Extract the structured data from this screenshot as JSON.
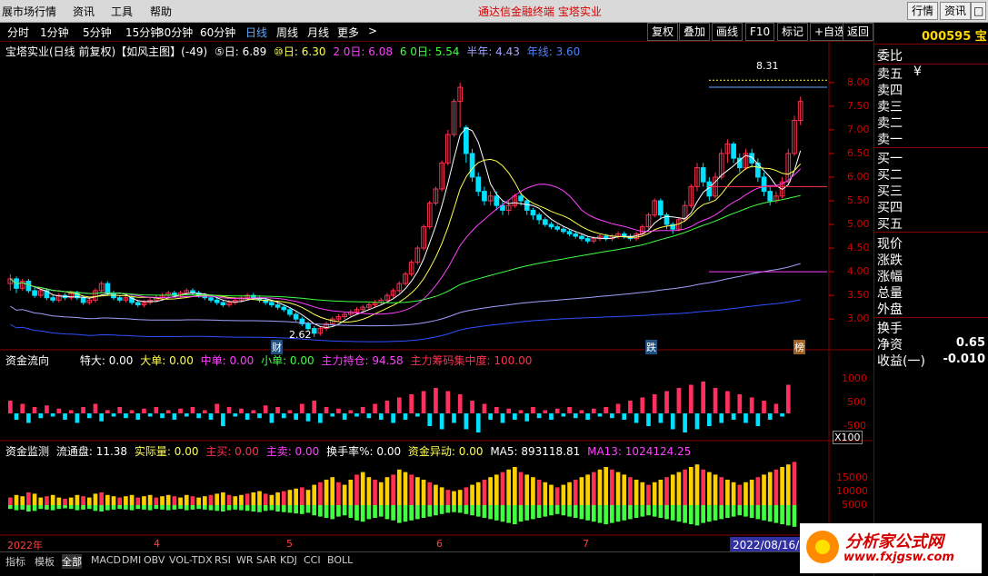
{
  "menubar": {
    "items": [
      "展市场行情",
      "资讯",
      "工具",
      "帮助"
    ],
    "brand": "通达信金融终端   宝塔实业",
    "right_buttons": [
      "行情",
      "资讯",
      "□",
      "×"
    ]
  },
  "periods": [
    "分时",
    "1分钟",
    "5分钟",
    "15分钟",
    "30分钟",
    "60分钟",
    "日线",
    "周线",
    "月线",
    "更多",
    ">"
  ],
  "active_period": "日线",
  "tools": [
    "复权",
    "叠加",
    "画线",
    "F10",
    "标记",
    "+自选",
    "返回"
  ],
  "main_legend": {
    "title": "宝塔实业(日线 前复权)【如风主图】(-49)",
    "ma5": "⑤日: 6.89",
    "ma10": "⑩日: 6.30",
    "ma20": "2 0日: 6.08",
    "ma60": "6 0日: 5.54",
    "half": "半年: 4.43",
    "year": "年线: 3.60"
  },
  "annotations": {
    "high": "8.31",
    "low": "2.62",
    "cai": "财",
    "die": "跌",
    "bang": "榜"
  },
  "price_ticks": [
    "8.00",
    "7.50",
    "7.00",
    "6.50",
    "6.00",
    "5.50",
    "5.00",
    "4.50",
    "4.00",
    "3.50",
    "3.00"
  ],
  "fund_legend": {
    "title": "资金流向",
    "tedas": "特大: 0.00",
    "da": "大单: 0.00",
    "zhong": "中单: 0.00",
    "xiao": "小单: 0.00",
    "hold": "主力持仓: 94.58",
    "conc": "主力筹码集中度: 100.00"
  },
  "fund_ticks": [
    "1000",
    "500",
    "-500"
  ],
  "fund_unit": "X100",
  "vol_legend": {
    "title": "资金监测",
    "float": "流通盘: 11.38",
    "actual": "实际量: 0.00",
    "buy": "主买: 0.00",
    "sell": "主卖: 0.00",
    "turn": "换手率%: 0.00",
    "move": "资金异动: 0.00",
    "ma5": "MA5: 893118.81",
    "ma13": "MA13: 1024124.25"
  },
  "vol_ticks": [
    "15000",
    "10000",
    "5000"
  ],
  "months": [
    "2022年",
    "4",
    "5",
    "6",
    "7"
  ],
  "date_badge": "2022/08/16/二",
  "bottom_tabs": [
    "指标",
    "模板",
    "全部",
    "MACD",
    "DMI",
    "OBV",
    "VOL-TDX",
    "RSI",
    "WR",
    "SAR",
    "KDJ",
    "CCI",
    "BOLL"
  ],
  "active_tab": "全部",
  "side": {
    "code": "000595 宝",
    "labels": [
      "委比",
      "卖五",
      "卖四",
      "卖三",
      "卖二",
      "卖一",
      "买一",
      "买二",
      "买三",
      "买四",
      "买五",
      "现价",
      "涨跌",
      "涨幅",
      "总量",
      "外盘",
      "换手",
      "净资",
      "收益(一)"
    ],
    "sell5_unit": "¥",
    "netasset": "0.65",
    "earn": "-0.010"
  },
  "watermark": {
    "text": "分析家公式网",
    "url": "www.fxjgsw.com"
  },
  "colors": {
    "up": "#ff3050",
    "down": "#00e0ff",
    "ma5": "#ffffff",
    "ma10": "#ffff50",
    "ma20": "#ff40ff",
    "ma60": "#40ff40",
    "half": "#a0a0ff",
    "year": "#3050ff"
  },
  "chart_data": {
    "type": "candlestick",
    "ylim": [
      2.6,
      8.4
    ],
    "candles": [
      [
        3.75,
        3.85,
        3.6,
        3.95
      ],
      [
        3.85,
        3.65,
        3.55,
        3.9
      ],
      [
        3.65,
        3.8,
        3.6,
        3.85
      ],
      [
        3.8,
        3.6,
        3.55,
        3.85
      ],
      [
        3.6,
        3.5,
        3.45,
        3.7
      ],
      [
        3.5,
        3.6,
        3.45,
        3.65
      ],
      [
        3.6,
        3.45,
        3.4,
        3.65
      ],
      [
        3.45,
        3.4,
        3.35,
        3.5
      ],
      [
        3.4,
        3.5,
        3.35,
        3.55
      ],
      [
        3.5,
        3.45,
        3.4,
        3.55
      ],
      [
        3.45,
        3.55,
        3.4,
        3.6
      ],
      [
        3.55,
        3.45,
        3.4,
        3.6
      ],
      [
        3.45,
        3.35,
        3.3,
        3.5
      ],
      [
        3.35,
        3.4,
        3.3,
        3.45
      ],
      [
        3.4,
        3.6,
        3.35,
        3.65
      ],
      [
        3.6,
        3.75,
        3.55,
        3.8
      ],
      [
        3.75,
        3.55,
        3.5,
        3.8
      ],
      [
        3.55,
        3.45,
        3.4,
        3.6
      ],
      [
        3.45,
        3.4,
        3.35,
        3.5
      ],
      [
        3.4,
        3.45,
        3.35,
        3.5
      ],
      [
        3.45,
        3.35,
        3.3,
        3.5
      ],
      [
        3.35,
        3.3,
        3.25,
        3.4
      ],
      [
        3.3,
        3.35,
        3.25,
        3.4
      ],
      [
        3.35,
        3.4,
        3.3,
        3.45
      ],
      [
        3.4,
        3.45,
        3.35,
        3.5
      ],
      [
        3.45,
        3.5,
        3.4,
        3.55
      ],
      [
        3.5,
        3.55,
        3.45,
        3.6
      ],
      [
        3.55,
        3.5,
        3.45,
        3.6
      ],
      [
        3.5,
        3.55,
        3.45,
        3.6
      ],
      [
        3.55,
        3.6,
        3.5,
        3.65
      ],
      [
        3.6,
        3.55,
        3.5,
        3.65
      ],
      [
        3.55,
        3.5,
        3.45,
        3.6
      ],
      [
        3.5,
        3.45,
        3.4,
        3.55
      ],
      [
        3.45,
        3.4,
        3.35,
        3.5
      ],
      [
        3.4,
        3.35,
        3.3,
        3.45
      ],
      [
        3.35,
        3.3,
        3.25,
        3.4
      ],
      [
        3.3,
        3.35,
        3.25,
        3.4
      ],
      [
        3.35,
        3.4,
        3.3,
        3.45
      ],
      [
        3.4,
        3.45,
        3.35,
        3.5
      ],
      [
        3.45,
        3.5,
        3.4,
        3.55
      ],
      [
        3.5,
        3.45,
        3.4,
        3.55
      ],
      [
        3.45,
        3.4,
        3.35,
        3.5
      ],
      [
        3.4,
        3.35,
        3.3,
        3.45
      ],
      [
        3.35,
        3.3,
        3.25,
        3.4
      ],
      [
        3.3,
        3.25,
        3.2,
        3.35
      ],
      [
        3.25,
        3.2,
        3.15,
        3.3
      ],
      [
        3.2,
        3.1,
        3.05,
        3.25
      ],
      [
        3.1,
        3.0,
        2.95,
        3.15
      ],
      [
        3.0,
        2.9,
        2.85,
        3.05
      ],
      [
        2.9,
        2.8,
        2.75,
        2.95
      ],
      [
        2.8,
        2.7,
        2.62,
        2.85
      ],
      [
        2.7,
        2.8,
        2.65,
        2.85
      ],
      [
        2.8,
        2.9,
        2.75,
        2.95
      ],
      [
        2.9,
        3.0,
        2.85,
        3.05
      ],
      [
        3.0,
        3.05,
        2.95,
        3.1
      ],
      [
        3.05,
        3.1,
        3.0,
        3.15
      ],
      [
        3.1,
        3.15,
        3.05,
        3.2
      ],
      [
        3.15,
        3.2,
        3.1,
        3.25
      ],
      [
        3.2,
        3.25,
        3.15,
        3.3
      ],
      [
        3.25,
        3.3,
        3.2,
        3.35
      ],
      [
        3.3,
        3.35,
        3.25,
        3.4
      ],
      [
        3.35,
        3.4,
        3.3,
        3.45
      ],
      [
        3.4,
        3.5,
        3.35,
        3.55
      ],
      [
        3.5,
        3.6,
        3.45,
        3.65
      ],
      [
        3.6,
        3.75,
        3.55,
        3.8
      ],
      [
        3.75,
        3.95,
        3.7,
        4.0
      ],
      [
        3.95,
        4.2,
        3.9,
        4.25
      ],
      [
        4.2,
        4.5,
        4.15,
        4.55
      ],
      [
        4.5,
        4.95,
        4.45,
        5.0
      ],
      [
        4.95,
        5.45,
        4.9,
        5.5
      ],
      [
        5.45,
        5.75,
        5.4,
        5.8
      ],
      [
        5.75,
        6.3,
        5.7,
        6.35
      ],
      [
        6.3,
        6.9,
        6.25,
        7.0
      ],
      [
        6.9,
        7.6,
        6.85,
        7.65
      ],
      [
        7.6,
        7.9,
        7.05,
        8.0
      ],
      [
        7.05,
        6.5,
        6.3,
        7.1
      ],
      [
        6.5,
        6.0,
        5.9,
        6.6
      ],
      [
        6.0,
        5.7,
        5.6,
        6.1
      ],
      [
        5.7,
        5.5,
        5.4,
        5.8
      ],
      [
        5.5,
        5.6,
        5.4,
        5.7
      ],
      [
        5.6,
        5.4,
        5.3,
        5.7
      ],
      [
        5.4,
        5.3,
        5.2,
        5.5
      ],
      [
        5.3,
        5.4,
        5.2,
        5.5
      ],
      [
        5.4,
        5.6,
        5.35,
        5.65
      ],
      [
        5.6,
        5.5,
        5.4,
        5.7
      ],
      [
        5.5,
        5.3,
        5.2,
        5.55
      ],
      [
        5.3,
        5.2,
        5.1,
        5.35
      ],
      [
        5.2,
        5.1,
        5.0,
        5.25
      ],
      [
        5.1,
        5.0,
        4.95,
        5.15
      ],
      [
        5.0,
        4.95,
        4.9,
        5.05
      ],
      [
        4.95,
        4.9,
        4.85,
        5.0
      ],
      [
        4.9,
        4.85,
        4.8,
        4.95
      ],
      [
        4.85,
        4.8,
        4.75,
        4.9
      ],
      [
        4.8,
        4.75,
        4.7,
        4.85
      ],
      [
        4.75,
        4.7,
        4.65,
        4.8
      ],
      [
        4.7,
        4.65,
        4.6,
        4.75
      ],
      [
        4.65,
        4.7,
        4.6,
        4.75
      ],
      [
        4.7,
        4.75,
        4.65,
        4.8
      ],
      [
        4.75,
        4.7,
        4.65,
        4.8
      ],
      [
        4.7,
        4.75,
        4.65,
        4.8
      ],
      [
        4.75,
        4.8,
        4.7,
        4.85
      ],
      [
        4.8,
        4.75,
        4.7,
        4.85
      ],
      [
        4.75,
        4.7,
        4.65,
        4.8
      ],
      [
        4.7,
        4.8,
        4.65,
        4.85
      ],
      [
        4.8,
        4.95,
        4.75,
        5.0
      ],
      [
        4.95,
        5.2,
        4.9,
        5.25
      ],
      [
        5.2,
        5.5,
        5.15,
        5.55
      ],
      [
        5.5,
        5.2,
        5.1,
        5.55
      ],
      [
        5.2,
        5.0,
        4.9,
        5.25
      ],
      [
        5.0,
        4.9,
        4.8,
        5.05
      ],
      [
        4.9,
        5.1,
        4.85,
        5.15
      ],
      [
        5.1,
        5.4,
        5.05,
        5.5
      ],
      [
        5.4,
        5.8,
        5.35,
        5.85
      ],
      [
        5.8,
        6.2,
        5.7,
        6.3
      ],
      [
        6.2,
        5.9,
        5.8,
        6.3
      ],
      [
        5.9,
        5.6,
        5.5,
        6.0
      ],
      [
        5.6,
        6.0,
        5.55,
        6.1
      ],
      [
        6.0,
        6.5,
        5.95,
        6.6
      ],
      [
        6.5,
        6.7,
        6.3,
        6.8
      ],
      [
        6.7,
        6.4,
        6.3,
        6.75
      ],
      [
        6.4,
        6.2,
        6.1,
        6.5
      ],
      [
        6.2,
        6.5,
        6.15,
        6.6
      ],
      [
        6.5,
        6.3,
        6.2,
        6.6
      ],
      [
        6.3,
        6.0,
        5.9,
        6.4
      ],
      [
        6.0,
        5.7,
        5.6,
        6.1
      ],
      [
        5.7,
        5.5,
        5.4,
        5.8
      ],
      [
        5.5,
        5.6,
        5.45,
        5.7
      ],
      [
        5.6,
        5.9,
        5.55,
        6.0
      ],
      [
        5.9,
        6.5,
        5.85,
        6.6
      ],
      [
        6.5,
        7.2,
        6.45,
        7.3
      ],
      [
        7.2,
        7.6,
        7.1,
        7.7
      ]
    ],
    "fund_flow": [
      400,
      -200,
      300,
      -300,
      200,
      -150,
      250,
      -100,
      150,
      -200,
      100,
      -300,
      200,
      -150,
      300,
      -250,
      100,
      -100,
      200,
      -150,
      100,
      -200,
      150,
      -100,
      200,
      -150,
      100,
      -200,
      150,
      -100,
      200,
      -150,
      100,
      -200,
      300,
      -400,
      200,
      -100,
      150,
      -200,
      100,
      -150,
      250,
      -300,
      200,
      -150,
      100,
      -200,
      300,
      -250,
      400,
      -300,
      200,
      -100,
      150,
      -200,
      100,
      -100,
      200,
      -150,
      300,
      -200,
      400,
      -300,
      500,
      -200,
      600,
      -100,
      700,
      -400,
      800,
      -500,
      700,
      -300,
      600,
      -500,
      400,
      -600,
      300,
      -200,
      200,
      -300,
      150,
      -200,
      100,
      -250,
      200,
      -150,
      100,
      -200,
      150,
      -100,
      200,
      -150,
      100,
      -200,
      150,
      -100,
      200,
      -150,
      300,
      -200,
      400,
      -300,
      500,
      -400,
      600,
      -300,
      700,
      -500,
      800,
      -600,
      900,
      -500,
      1000,
      -400,
      800,
      -300,
      700,
      -200,
      600,
      -300,
      500,
      -400,
      400,
      -200,
      300,
      -100,
      900
    ],
    "volume": [
      3000,
      4000,
      3500,
      5000,
      4500,
      3000,
      3500,
      4000,
      3000,
      2500,
      3000,
      4000,
      3500,
      3000,
      4500,
      5000,
      4000,
      3500,
      3000,
      3500,
      4000,
      3000,
      3500,
      4000,
      3000,
      3500,
      4000,
      3500,
      3000,
      4000,
      3500,
      3000,
      3500,
      4000,
      4500,
      5000,
      4000,
      3500,
      4000,
      4500,
      5000,
      5500,
      4500,
      4000,
      5000,
      5500,
      6000,
      6500,
      7000,
      6000,
      8000,
      9000,
      10000,
      11000,
      9000,
      8000,
      10000,
      12000,
      13000,
      11000,
      10000,
      9000,
      11000,
      12000,
      14000,
      13000,
      12000,
      11000,
      10000,
      9000,
      8000,
      7000,
      6000,
      5500,
      6000,
      7000,
      8000,
      9000,
      10000,
      11000,
      12000,
      13000,
      14000,
      15000,
      13000,
      12000,
      11000,
      10000,
      9000,
      8000,
      7000,
      8000,
      9000,
      10000,
      11000,
      12000,
      13000,
      14000,
      15000,
      14000,
      13000,
      12000,
      11000,
      10000,
      9000,
      8000,
      9000,
      10000,
      11000,
      12000,
      13000,
      14000,
      15000,
      16000,
      14000,
      13000,
      12000,
      11000,
      10000,
      9000,
      8000,
      9000,
      10000,
      11000,
      12000,
      13000,
      14000,
      15000,
      16000,
      17000
    ]
  }
}
